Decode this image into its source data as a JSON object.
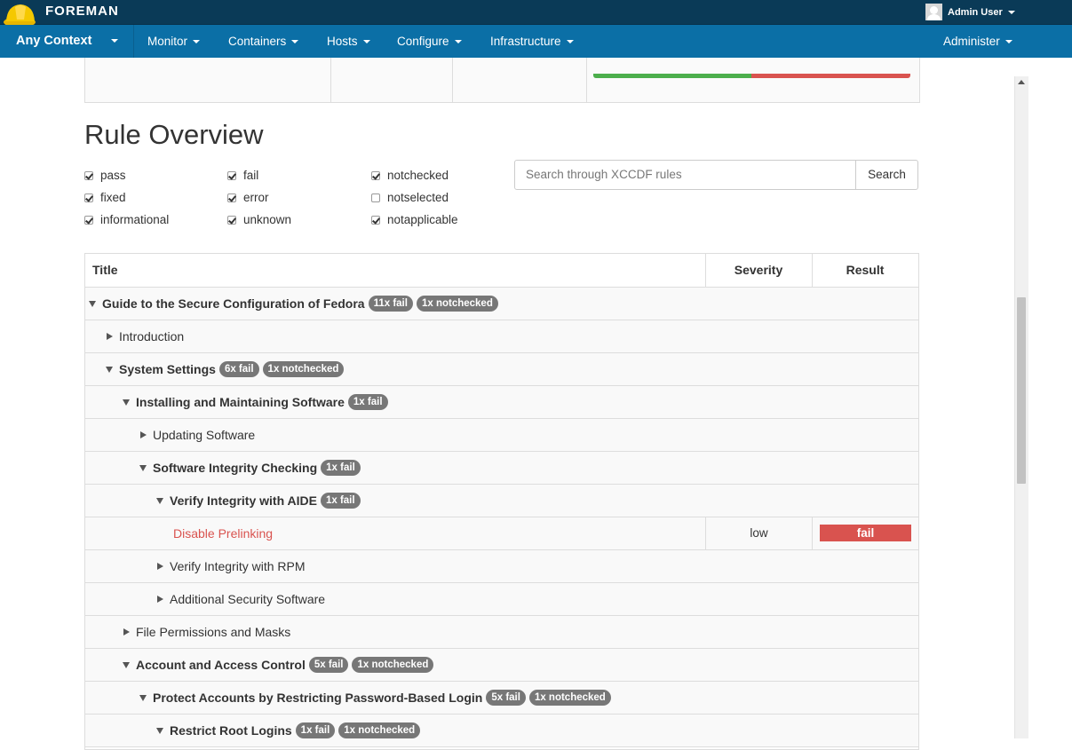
{
  "app": {
    "brand": "FOREMAN",
    "user": "Admin User"
  },
  "nav": {
    "context": "Any Context",
    "items": [
      "Monitor",
      "Containers",
      "Hosts",
      "Configure",
      "Infrastructure"
    ],
    "admin": "Administer"
  },
  "heading": "Rule Overview",
  "filters": [
    {
      "label": "pass",
      "checked": true
    },
    {
      "label": "fail",
      "checked": true
    },
    {
      "label": "notchecked",
      "checked": true
    },
    {
      "label": "fixed",
      "checked": true
    },
    {
      "label": "error",
      "checked": true
    },
    {
      "label": "notselected",
      "checked": false
    },
    {
      "label": "informational",
      "checked": true
    },
    {
      "label": "unknown",
      "checked": true
    },
    {
      "label": "notapplicable",
      "checked": true
    }
  ],
  "search": {
    "placeholder": "Search through XCCDF rules",
    "button": "Search"
  },
  "table": {
    "headers": [
      "Title",
      "Severity",
      "Result"
    ],
    "rows": [
      {
        "title": "Guide to the Secure Configuration of Fedora",
        "expanded": true,
        "bold": true,
        "badges": [
          "11x fail",
          "1x notchecked"
        ],
        "level": 0
      },
      {
        "title": "Introduction",
        "expanded": false,
        "bold": false,
        "badges": [],
        "level": 1
      },
      {
        "title": "System Settings",
        "expanded": true,
        "bold": true,
        "badges": [
          "6x fail",
          "1x notchecked"
        ],
        "level": 1
      },
      {
        "title": "Installing and Maintaining Software",
        "expanded": true,
        "bold": true,
        "badges": [
          "1x fail"
        ],
        "level": 2
      },
      {
        "title": "Updating Software",
        "expanded": false,
        "bold": false,
        "badges": [],
        "level": 3
      },
      {
        "title": "Software Integrity Checking",
        "expanded": true,
        "bold": true,
        "badges": [
          "1x fail"
        ],
        "level": 3
      },
      {
        "title": "Verify Integrity with AIDE",
        "expanded": true,
        "bold": true,
        "badges": [
          "1x fail"
        ],
        "level": 4
      },
      {
        "title": "Disable Prelinking",
        "rule": true,
        "severity": "low",
        "result": "fail",
        "level": 5
      },
      {
        "title": "Verify Integrity with RPM",
        "expanded": false,
        "bold": false,
        "badges": [],
        "level": 4
      },
      {
        "title": "Additional Security Software",
        "expanded": false,
        "bold": false,
        "badges": [],
        "level": 4
      },
      {
        "title": "File Permissions and Masks",
        "expanded": false,
        "bold": false,
        "badges": [],
        "level": 2
      },
      {
        "title": "Account and Access Control",
        "expanded": true,
        "bold": true,
        "badges": [
          "5x fail",
          "1x notchecked"
        ],
        "level": 2
      },
      {
        "title": "Protect Accounts by Restricting Password-Based Login",
        "expanded": true,
        "bold": true,
        "badges": [
          "5x fail",
          "1x notchecked"
        ],
        "level": 3
      },
      {
        "title": "Restrict Root Logins",
        "expanded": true,
        "bold": true,
        "badges": [
          "1x fail",
          "1x notchecked"
        ],
        "level": 4
      }
    ]
  },
  "colors": {
    "topbar": "#0a3a57",
    "navbar": "#0b6fa6",
    "fail": "#d9534f",
    "pass": "#4cae4c",
    "badge": "#777777"
  }
}
